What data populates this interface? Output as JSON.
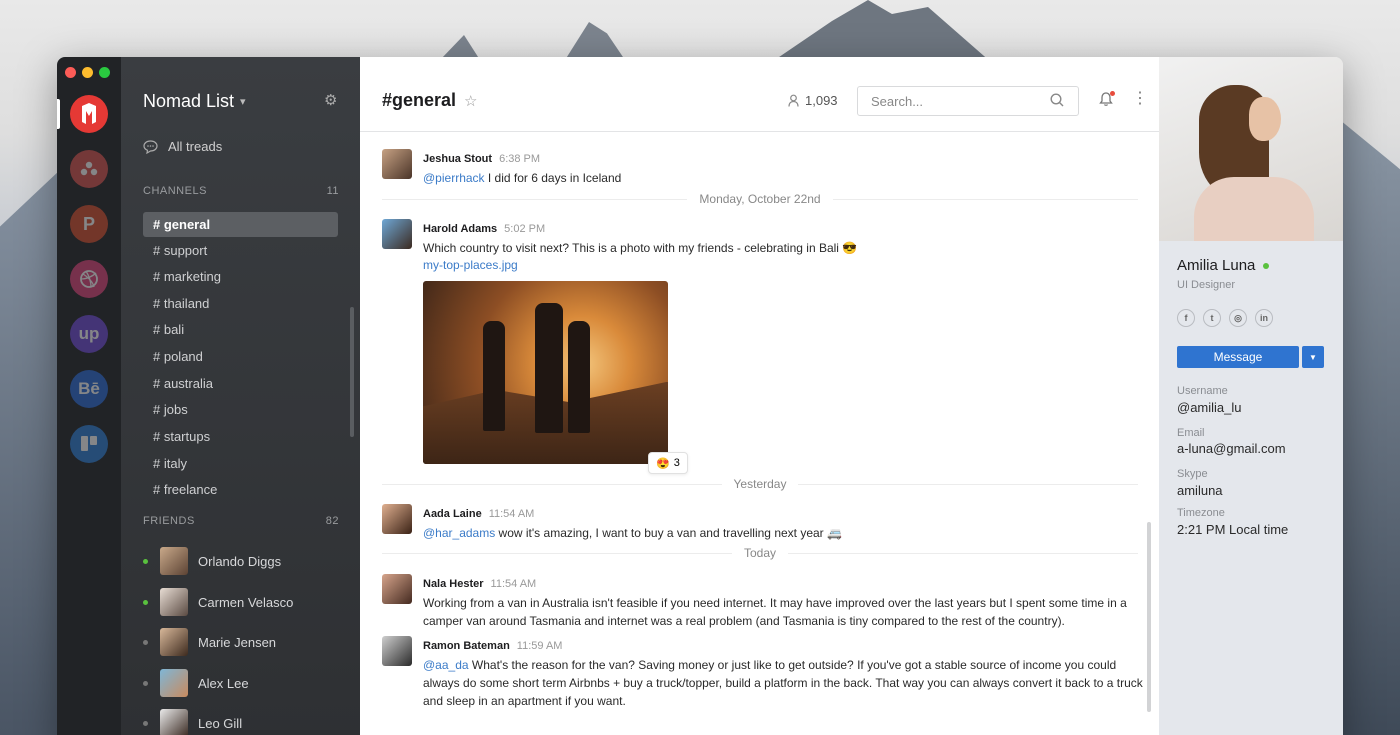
{
  "workspace": {
    "name": "Nomad List",
    "workspaces": [
      {
        "label": "",
        "color": "#e53935"
      },
      {
        "label": "",
        "color": "#d9534f"
      },
      {
        "label": "P",
        "color": "#d84e2e"
      },
      {
        "label": "",
        "color": "#e0447b"
      },
      {
        "label": "up",
        "color": "#6f4ad8"
      },
      {
        "label": "Bē",
        "color": "#2a6bd8"
      },
      {
        "label": "",
        "color": "#2d7fd8"
      }
    ]
  },
  "sidebar": {
    "all_threads": "All treads",
    "channels_header": "CHANNELS",
    "channels_count": "11",
    "channels": [
      "# general",
      "# support",
      "# marketing",
      "# thailand",
      "# bali",
      "# poland",
      "# australia",
      "# jobs",
      "# startups",
      "# italy",
      "# freelance"
    ],
    "friends_header": "FRIENDS",
    "friends_count": "82",
    "friends": [
      {
        "name": "Orlando Diggs",
        "online": true
      },
      {
        "name": "Carmen Velasco",
        "online": true
      },
      {
        "name": "Marie Jensen",
        "online": false
      },
      {
        "name": "Alex Lee",
        "online": false
      },
      {
        "name": "Leo Gill",
        "online": false
      }
    ]
  },
  "channel": {
    "title": "#general",
    "members": "1,093",
    "search_placeholder": "Search..."
  },
  "messages": {
    "m1": {
      "name": "Jeshua Stout",
      "time": "6:38 PM",
      "mention": "@pierrhack",
      "text": " I did for 6 days in Iceland"
    },
    "d1": "Monday, October 22nd",
    "m2": {
      "name": "Harold Adams",
      "time": "5:02 PM",
      "text": "Which country to visit next? This is a photo with my friends - celebrating in Bali 😎",
      "link": "my-top-places.jpg",
      "reaction_emoji": "😍",
      "reaction_count": "3"
    },
    "d2": "Yesterday",
    "m3": {
      "name": "Aada Laine",
      "time": "11:54 AM",
      "mention": "@har_adams",
      "text": " wow it's amazing, I want to buy a van and travelling next year 🚐"
    },
    "d3": "Today",
    "m4": {
      "name": "Nala Hester",
      "time": "11:54 AM",
      "text": "Working from a van in Australia isn't feasible if you need internet. It may have improved over the last years but I spent some time in a camper van around Tasmania and internet was a real problem (and Tasmania is tiny compared to the rest of the country)."
    },
    "m5": {
      "name": "Ramon Bateman",
      "time": "11:59 AM",
      "mention": "@aa_da",
      "text": " What's the reason for the van? Saving money or just like to get outside? If you've got a stable source of income you could always do some short term Airbnbs + buy a truck/topper, build a platform in the back. That way you can always convert it back to a truck and sleep in an apartment if you want."
    }
  },
  "profile": {
    "name": "Amilia Luna",
    "role": "UI Designer",
    "message_button": "Message",
    "username_label": "Username",
    "username": "@amilia_lu",
    "email_label": "Email",
    "email": "a-luna@gmail.com",
    "skype_label": "Skype",
    "skype": "amiluna",
    "timezone_label": "Timezone",
    "timezone": "2:21 PM Local time"
  }
}
